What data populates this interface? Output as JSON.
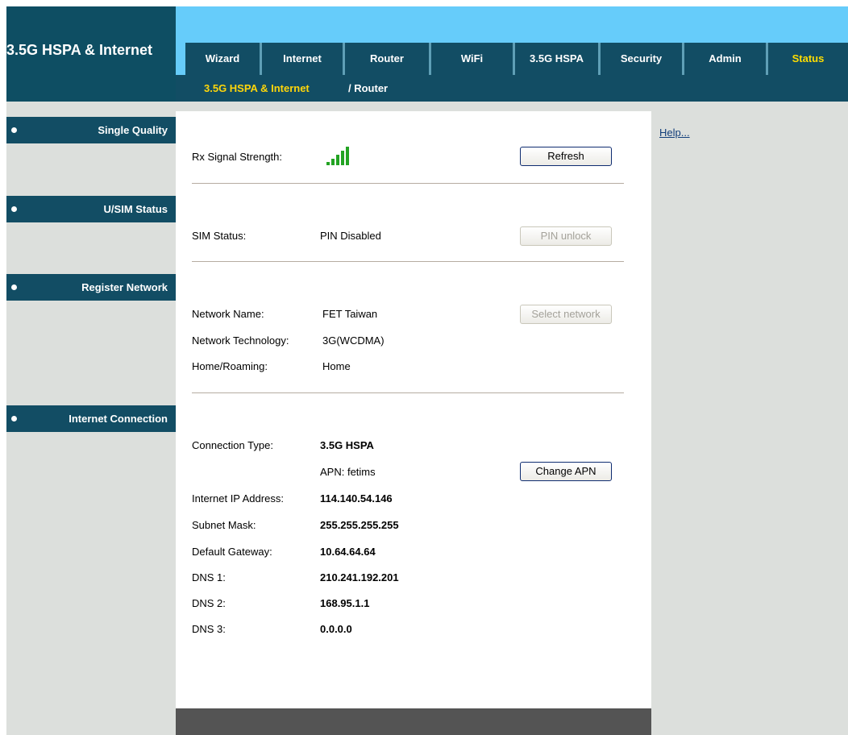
{
  "brand": {
    "title": "3.5G HSPA & Internet"
  },
  "tabs": [
    {
      "label": "Wizard",
      "active": false
    },
    {
      "label": "Internet",
      "active": false
    },
    {
      "label": "Router",
      "active": false
    },
    {
      "label": "WiFi",
      "active": false
    },
    {
      "label": "3.5G HSPA",
      "active": false
    },
    {
      "label": "Security",
      "active": false
    },
    {
      "label": "Admin",
      "active": false
    },
    {
      "label": "Status",
      "active": true
    }
  ],
  "subnav": {
    "first": "3.5G HSPA & Internet",
    "second": "/ Router"
  },
  "sidebar": {
    "sections": [
      "Single Quality",
      "U/SIM Status",
      "Register Network",
      "Internet Connection"
    ]
  },
  "help": {
    "label": "Help..."
  },
  "signal": {
    "label": "Rx Signal Strength:",
    "bars": 5,
    "refresh_button": "Refresh"
  },
  "sim": {
    "label": "SIM Status:",
    "value": "PIN Disabled",
    "pin_unlock_button": "PIN unlock"
  },
  "network": {
    "name_label": "Network Name:",
    "name_value": "FET Taiwan",
    "select_button": "Select network",
    "tech_label": "Network Technology:",
    "tech_value": "3G(WCDMA)",
    "roaming_label": "Home/Roaming:",
    "roaming_value": "Home"
  },
  "connection": {
    "type_label": "Connection Type:",
    "type_value": "3.5G HSPA",
    "apn": "APN: fetims",
    "change_apn_button": "Change APN",
    "ip_label": "Internet IP Address:",
    "ip_value": "114.140.54.146",
    "mask_label": "Subnet Mask:",
    "mask_value": "255.255.255.255",
    "gateway_label": "Default Gateway:",
    "gateway_value": "10.64.64.64",
    "dns1_label": "DNS 1:",
    "dns1_value": "210.241.192.201",
    "dns2_label": "DNS 2:",
    "dns2_value": "168.95.1.1",
    "dns3_label": "DNS 3:",
    "dns3_value": "0.0.0.0"
  },
  "colors": {
    "header_dark": "#124d64",
    "header_light": "#66ccfa",
    "active_tab_text": "#ffdd00",
    "signal_green": "#23a323",
    "panel_grey": "#dcdfdc"
  }
}
